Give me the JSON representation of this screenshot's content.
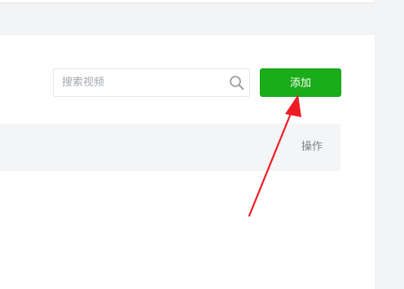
{
  "toolbar": {
    "search": {
      "placeholder": "搜索视频",
      "value": "",
      "icon": "search-icon"
    },
    "add_label": "添加",
    "add_color": "#1aad19"
  },
  "table": {
    "columns": [
      {
        "label": "操作"
      }
    ]
  },
  "annotation": {
    "color": "#ee1c25",
    "icon": "red-arrow-pointing-to-add-button"
  }
}
